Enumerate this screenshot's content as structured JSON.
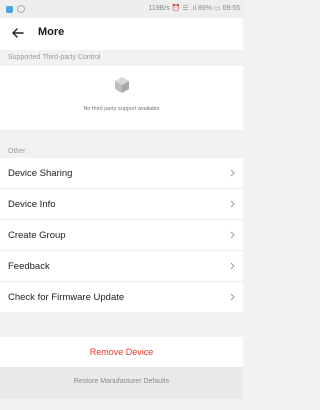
{
  "statusbar": {
    "info": "119B/s ⏰ ☰ .ıl 89% ▭ 09:55"
  },
  "header": {
    "title": "More"
  },
  "third_party": {
    "section_label": "Supported Third-party Control",
    "empty_message": "No third party support available"
  },
  "other": {
    "section_label": "Other",
    "items": [
      {
        "label": "Device Sharing"
      },
      {
        "label": "Device Info"
      },
      {
        "label": "Create Group"
      },
      {
        "label": "Feedback"
      },
      {
        "label": "Check for Firmware Update"
      }
    ]
  },
  "actions": {
    "remove_label": "Remove Device",
    "restore_label": "Restore Manufacturer Defaults"
  },
  "colors": {
    "danger": "#e53a2b",
    "background": "#f2f2f2"
  }
}
